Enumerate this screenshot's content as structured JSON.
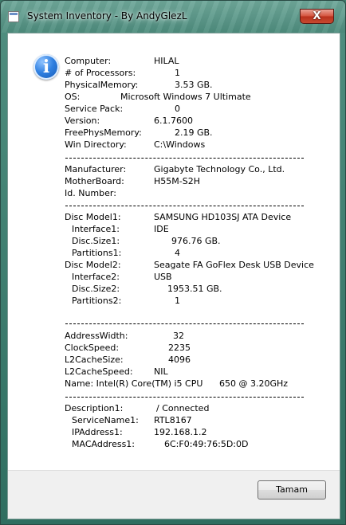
{
  "window": {
    "title": "System Inventory - By AndyGlezL",
    "close_glyph": "X",
    "icon": "info-icon"
  },
  "rows": [
    {
      "label": "Computer:",
      "value": "HILAL"
    },
    {
      "label": "# of Processors:",
      "value": "1"
    },
    {
      "label": "PhysicalMemory:",
      "value": "3.53 GB."
    },
    {
      "label": "OS:",
      "value": "Microsoft Windows 7 Ultimate"
    },
    {
      "label": "Service Pack:",
      "value": "0"
    },
    {
      "label": "Version:",
      "value": "6.1.7600"
    },
    {
      "label": "FreePhysMemory:",
      "value": "2.19 GB."
    },
    {
      "label": "Win Directory:",
      "value": "C:\\Windows"
    },
    {
      "label": "Manufacturer:",
      "value": "Gigabyte Technology Co., Ltd."
    },
    {
      "label": "MotherBoard:",
      "value": "H55M-S2H"
    },
    {
      "label": "Id. Number:",
      "value": ""
    },
    {
      "label": "Disc Model1:",
      "value": "SAMSUNG HD103SJ ATA Device"
    },
    {
      "label": "Interface1:",
      "value": "IDE"
    },
    {
      "label": "Disc.Size1:",
      "value": "976.76 GB."
    },
    {
      "label": "Partitions1:",
      "value": "4"
    },
    {
      "label": "Disc Model2:",
      "value": "Seagate FA GoFlex Desk USB Device"
    },
    {
      "label": "Interface2:",
      "value": "USB"
    },
    {
      "label": "Disc.Size2:",
      "value": "1953.51 GB."
    },
    {
      "label": "Partitions2:",
      "value": "1"
    },
    {
      "label": "AddressWidth:",
      "value": "32"
    },
    {
      "label": "ClockSpeed:",
      "value": "2235"
    },
    {
      "label": "L2CacheSize:",
      "value": "4096"
    },
    {
      "label": "L2CacheSpeed:",
      "value": "NIL"
    },
    {
      "label": "Name: Intel(R) Core(TM) i5 CPU",
      "value": "650  @ 3.20GHz"
    },
    {
      "label": "Description1:",
      "value": "/ Connected"
    },
    {
      "label": "ServiceName1:",
      "value": "RTL8167"
    },
    {
      "label": "IPAddress1:",
      "value": "192.168.1.2"
    },
    {
      "label": "MACAddress1:",
      "value": "6C:F0:49:76:5D:0D"
    }
  ],
  "separator": "--------------------------------------------------------------------",
  "footer": {
    "ok_label": "Tamam"
  }
}
